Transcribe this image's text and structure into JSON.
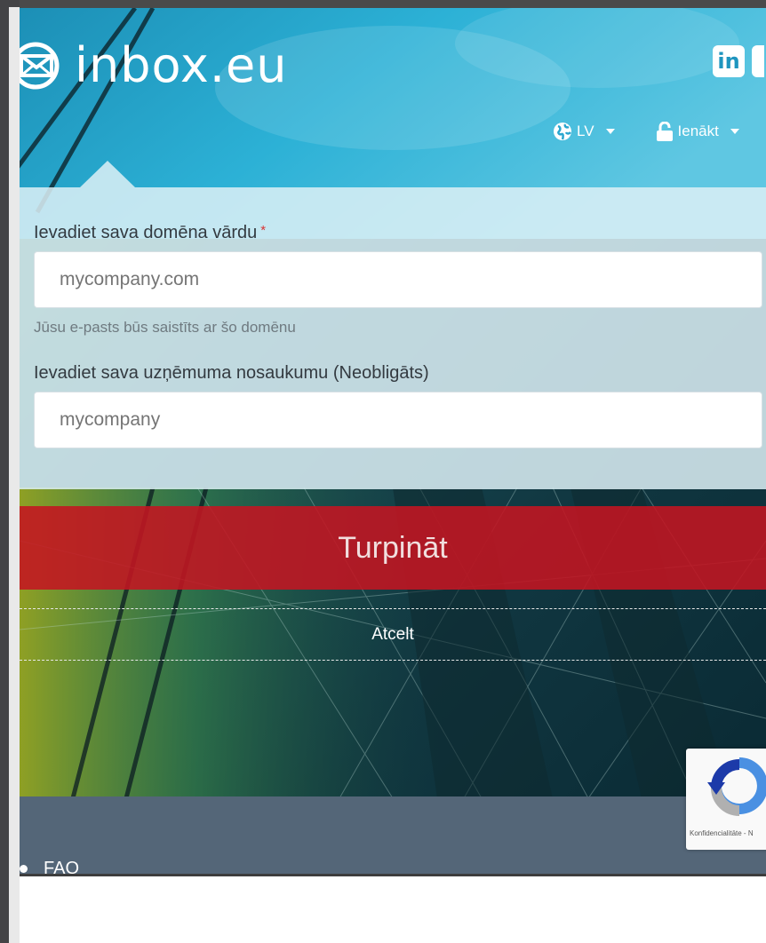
{
  "brand": {
    "name": "inbox.eu"
  },
  "header": {
    "social": [
      "in"
    ],
    "language": {
      "label": "LV"
    },
    "login": {
      "label": "Ienākt"
    }
  },
  "form": {
    "domain": {
      "label": "Ievadiet sava domēna vārdu",
      "required_mark": "*",
      "placeholder": "mycompany.com",
      "help": "Jūsu e-pasts būs saistīts ar šo domēnu"
    },
    "company": {
      "label": "Ievadiet sava uzņēmuma nosaukumu (Neobligāts)",
      "placeholder": "mycompany"
    },
    "continue_label": "Turpināt",
    "cancel_label": "Atcelt"
  },
  "footer": {
    "links": [
      "FAQ"
    ]
  },
  "recaptcha": {
    "privacy": "Konfidencialitāte - N"
  },
  "colors": {
    "accent_red": "#c41421",
    "footer_bg": "#546678",
    "header_sky": "#29a9cd"
  }
}
